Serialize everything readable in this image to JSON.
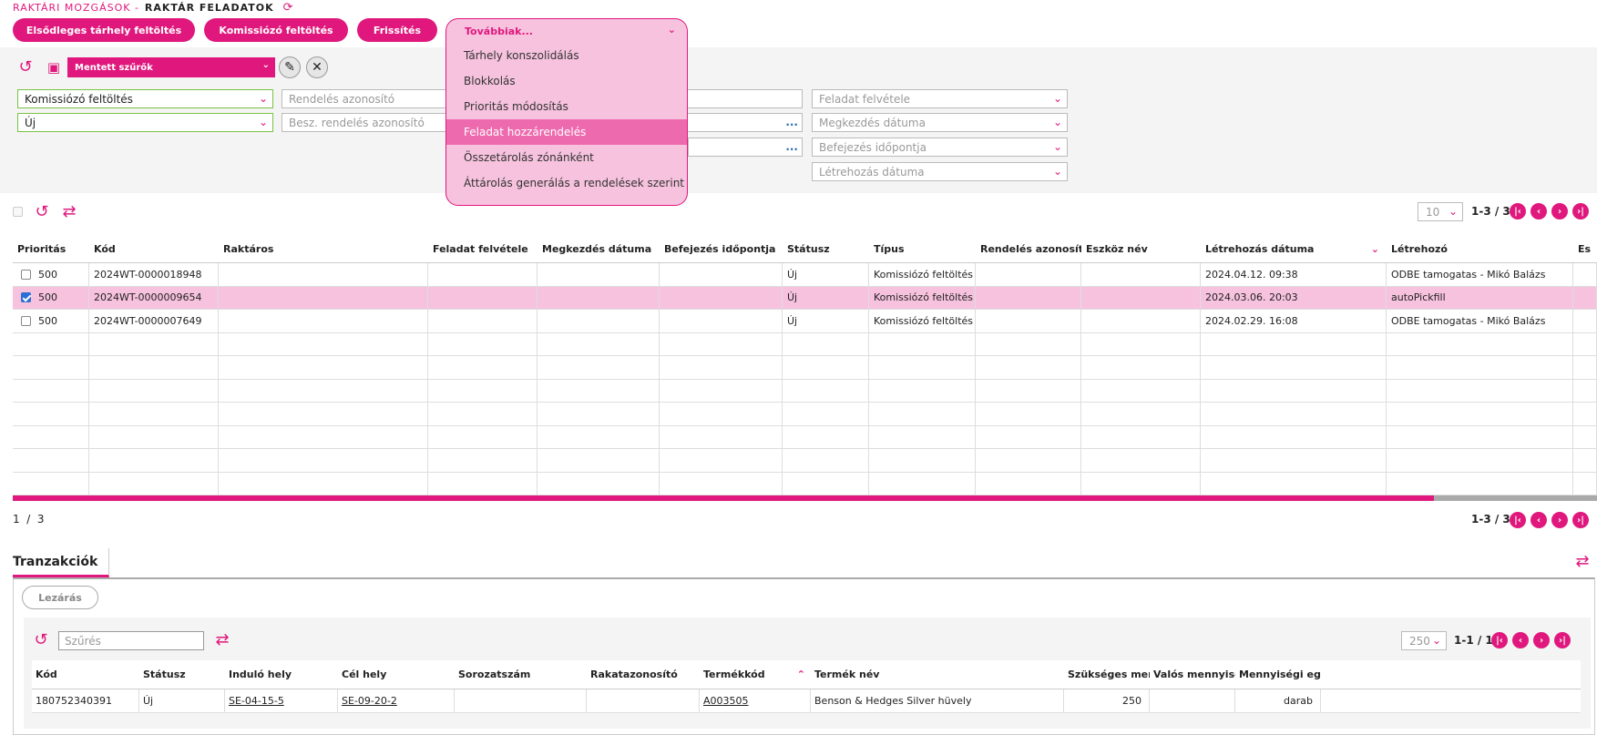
{
  "breadcrumb": {
    "parent": "RAKTÁRI MOZGÁSOK -",
    "current": "RAKTÁR FELADATOK"
  },
  "top_buttons": [
    "Elsődleges tárhely feltöltés",
    "Komissiózó feltöltés",
    "Frissítés"
  ],
  "more_menu": {
    "label": "Továbbiak...",
    "items": [
      "Tárhely konszolidálás",
      "Blokkolás",
      "Prioritás módosítás",
      "Feladat hozzárendelés",
      "Összetárolás zónánként",
      "Áttárolás generálás a rendelések szerint"
    ],
    "highlighted_index": 3
  },
  "saved_filters": {
    "label": "Mentett szűrők"
  },
  "filters": {
    "type": "Komissiózó feltöltés",
    "status": "Új",
    "order_id": "Rendelés azonosító",
    "purchase_order_id": "Besz. rendelés azonosító",
    "task_receive": "Feladat felvétele",
    "start_date": "Megkezdés dátuma",
    "end_time": "Befejezés időpontja",
    "created_date": "Létrehozás dátuma"
  },
  "grid": {
    "page_size": "10",
    "pager": "1-3 / 3",
    "footer_count": "1  /  3",
    "columns": [
      "Prioritás",
      "Kód",
      "Raktáros",
      "Feladat felvétele",
      "Megkezdés dátuma",
      "Befejezés időpontja",
      "Státusz",
      "Típus",
      "Rendelés azonosító",
      "Eszköz név",
      "Létrehozás dátuma",
      "Létrehozó",
      "Es"
    ],
    "rows": [
      {
        "checked": false,
        "priority": "500",
        "code": "2024WT-0000018948",
        "status": "Új",
        "type": "Komissiózó feltöltés",
        "created": "2024.04.12. 09:38",
        "creator": "ODBE tamogatas - Mikó Balázs"
      },
      {
        "checked": true,
        "priority": "500",
        "code": "2024WT-0000009654",
        "status": "Új",
        "type": "Komissiózó feltöltés",
        "created": "2024.03.06. 20:03",
        "creator": "autoPickfill"
      },
      {
        "checked": false,
        "priority": "500",
        "code": "2024WT-0000007649",
        "status": "Új",
        "type": "Komissiózó feltöltés",
        "created": "2024.02.29. 16:08",
        "creator": "ODBE tamogatas - Mikó Balázs"
      }
    ]
  },
  "transactions": {
    "tab_label": "Tranzakciók",
    "close_button": "Lezárás",
    "filter_placeholder": "Szűrés",
    "page_size": "250",
    "pager": "1-1 / 1",
    "columns": [
      "Kód",
      "Státusz",
      "Induló hely",
      "Cél hely",
      "Sorozatszám",
      "Rakatazonosító",
      "Termékkód",
      "Termék név",
      "Szükséges mennyiség",
      "Valós mennyiség",
      "Mennyiségi egység"
    ],
    "rows": [
      {
        "code": "180752340391",
        "status": "Új",
        "from": "SE-04-15-5",
        "to": "SE-09-20-2",
        "serial": "",
        "pallet": "",
        "product_code": "A003505",
        "product_name": "Benson & Hedges Silver hüvely",
        "required": "250",
        "actual": "",
        "unit": "darab"
      }
    ]
  },
  "colors": {
    "accent": "#e0187d",
    "highlight": "#f6c2de",
    "menu_hover": "#ee6aae",
    "valid_border": "#7cc242"
  }
}
